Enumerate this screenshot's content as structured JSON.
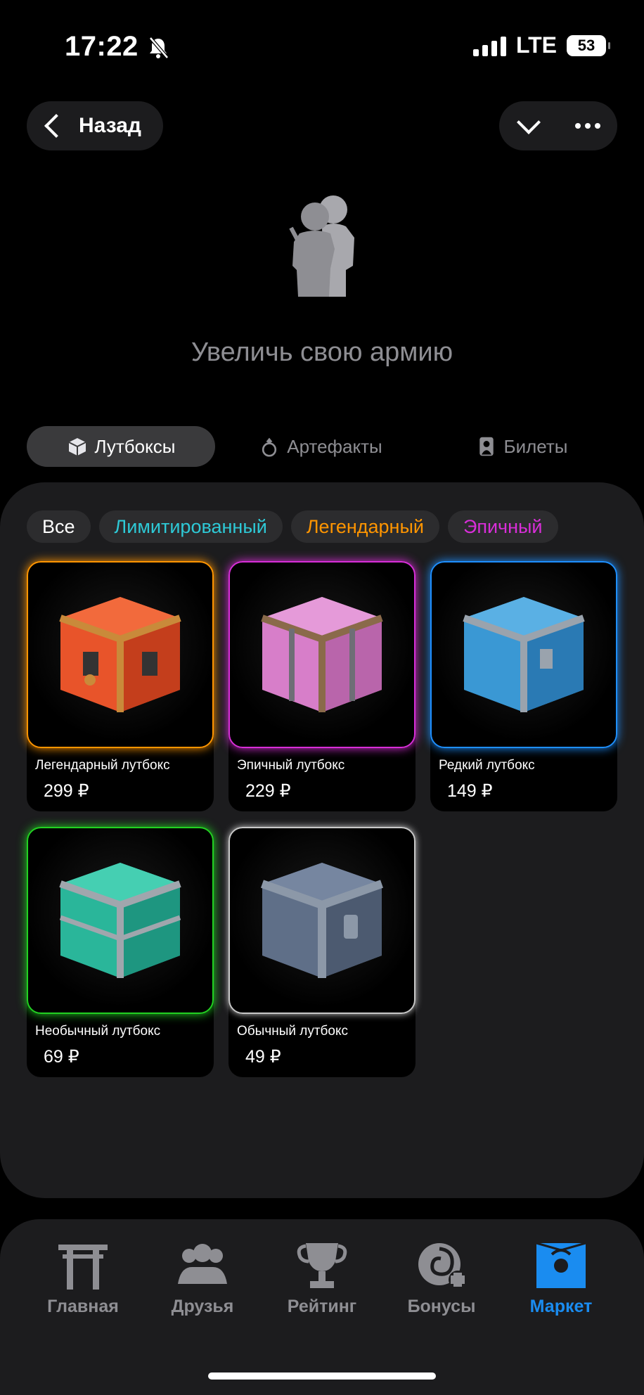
{
  "status_bar": {
    "time": "17:22",
    "network": "LTE",
    "battery": "53"
  },
  "header": {
    "back_label": "Назад"
  },
  "hero": {
    "title": "Увеличь свою армию",
    "icon": "soldiers-icon"
  },
  "tabs": [
    {
      "label": "Лутбоксы",
      "icon": "cube-icon",
      "active": true
    },
    {
      "label": "Артефакты",
      "icon": "ring-icon",
      "active": false
    },
    {
      "label": "Билеты",
      "icon": "ticket-icon",
      "active": false
    }
  ],
  "filters": [
    {
      "label": "Все",
      "color": "#ffffff"
    },
    {
      "label": "Лимитированный",
      "color": "#2ec9d6"
    },
    {
      "label": "Легендарный",
      "color": "#ff9500"
    },
    {
      "label": "Эпичный",
      "color": "#d82ed8"
    }
  ],
  "products": [
    {
      "name": "Легендарный лутбокс",
      "price": "299 ₽",
      "border": "#ff9500",
      "box_color": "#e8542a",
      "trim": "#c98a3a"
    },
    {
      "name": "Эпичный лутбокс",
      "price": "229 ₽",
      "border": "#d82ed8",
      "box_color": "#d77ec9",
      "trim": "#8a6a4a"
    },
    {
      "name": "Редкий лутбокс",
      "price": "149 ₽",
      "border": "#1e8fff",
      "box_color": "#3a98d4",
      "trim": "#9aa3ad"
    },
    {
      "name": "Необычный лутбокс",
      "price": "69 ₽",
      "border": "#22d122",
      "box_color": "#2ab69a",
      "trim": "#a0a6ad"
    },
    {
      "name": "Обычный лутбокс",
      "price": "49 ₽",
      "border": "#c8c8c8",
      "box_color": "#5f6f88",
      "trim": "#8c98a8"
    }
  ],
  "nav": [
    {
      "label": "Главная",
      "icon": "torii-gate-icon",
      "active": false
    },
    {
      "label": "Друзья",
      "icon": "group-icon",
      "active": false
    },
    {
      "label": "Рейтинг",
      "icon": "trophy-icon",
      "active": false
    },
    {
      "label": "Бонусы",
      "icon": "spiral-plus-icon",
      "active": false
    },
    {
      "label": "Маркет",
      "icon": "shop-bag-icon",
      "active": true
    }
  ],
  "colors": {
    "accent": "#1a8cf0",
    "panel": "#1c1c1e",
    "muted": "#8e8e93"
  }
}
